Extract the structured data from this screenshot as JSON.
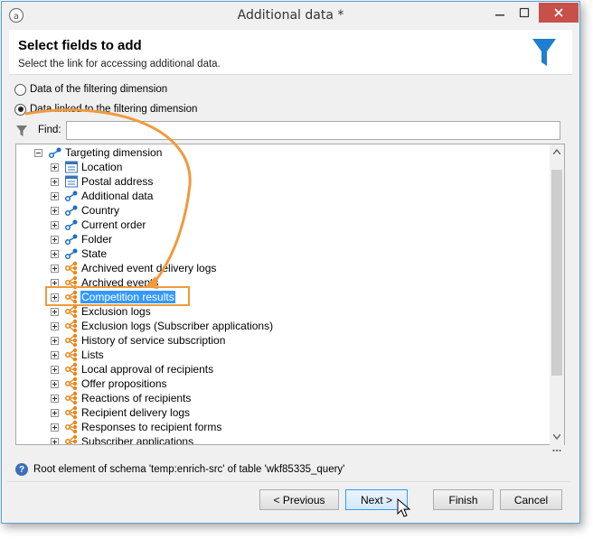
{
  "window": {
    "title": "Additional data *"
  },
  "header": {
    "title": "Select fields to add",
    "subtitle": "Select the link for accessing additional data."
  },
  "options": [
    {
      "label": "Data of the filtering dimension",
      "checked": false
    },
    {
      "label": "Data linked to the filtering dimension",
      "checked": true
    }
  ],
  "find": {
    "label": "Find:",
    "value": ""
  },
  "tree": {
    "root": "Targeting dimension",
    "items": [
      {
        "label": "Location",
        "icon": "table-icon"
      },
      {
        "label": "Postal address",
        "icon": "table-icon"
      },
      {
        "label": "Additional data",
        "icon": "link-icon"
      },
      {
        "label": "Country",
        "icon": "link-icon"
      },
      {
        "label": "Current order",
        "icon": "link-icon"
      },
      {
        "label": "Folder",
        "icon": "link-icon"
      },
      {
        "label": "State",
        "icon": "link-icon"
      },
      {
        "label": "Archived event delivery logs",
        "icon": "collection-link-icon"
      },
      {
        "label": "Archived events",
        "icon": "collection-link-icon"
      },
      {
        "label": "Competition results",
        "icon": "collection-link-icon",
        "selected": true
      },
      {
        "label": "Exclusion logs",
        "icon": "collection-link-icon"
      },
      {
        "label": "Exclusion logs (Subscriber applications)",
        "icon": "collection-link-icon"
      },
      {
        "label": "History of service subscription",
        "icon": "collection-link-icon"
      },
      {
        "label": "Lists",
        "icon": "collection-link-icon"
      },
      {
        "label": "Local approval of recipients",
        "icon": "collection-link-icon"
      },
      {
        "label": "Offer propositions",
        "icon": "collection-link-icon"
      },
      {
        "label": "Reactions of recipients",
        "icon": "collection-link-icon"
      },
      {
        "label": "Recipient delivery logs",
        "icon": "collection-link-icon"
      },
      {
        "label": "Responses to recipient forms",
        "icon": "collection-link-icon"
      },
      {
        "label": "Subscriber applications",
        "icon": "collection-link-icon"
      }
    ]
  },
  "status": {
    "text": "Root element of schema 'temp:enrich-src' of table 'wkf85335_query'"
  },
  "buttons": {
    "previous": "< Previous",
    "next": "Next >",
    "finish": "Finish",
    "cancel": "Cancel"
  },
  "colors": {
    "accent": "#3399ff",
    "highlight": "#ef9a3e",
    "close": "#c7504a",
    "funnel": "#1e7fd0"
  }
}
